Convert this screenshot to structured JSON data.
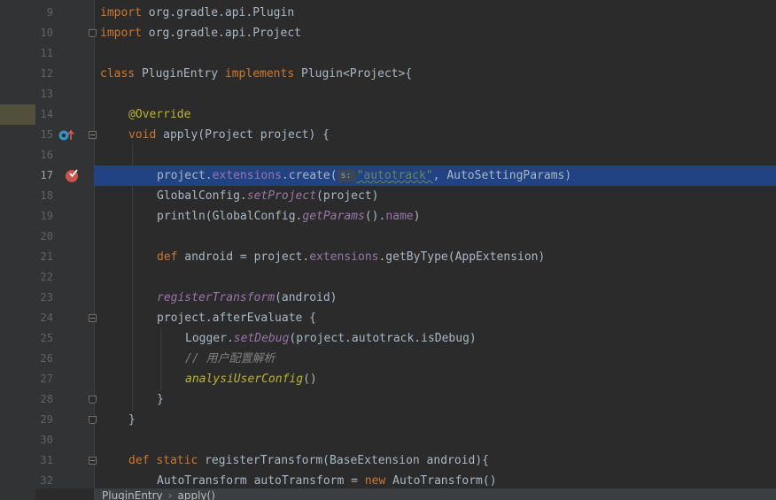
{
  "breadcrumb": {
    "items": [
      "PluginEntry",
      "apply()"
    ]
  },
  "editor": {
    "highlighted_line": 17,
    "lines": [
      {
        "n": "9"
      },
      {
        "n": "10"
      },
      {
        "n": "11"
      },
      {
        "n": "12"
      },
      {
        "n": "13"
      },
      {
        "n": "14"
      },
      {
        "n": "15"
      },
      {
        "n": "16"
      },
      {
        "n": "17"
      },
      {
        "n": "18"
      },
      {
        "n": "19"
      },
      {
        "n": "20"
      },
      {
        "n": "21"
      },
      {
        "n": "22"
      },
      {
        "n": "23"
      },
      {
        "n": "24"
      },
      {
        "n": "25"
      },
      {
        "n": "26"
      },
      {
        "n": "27"
      },
      {
        "n": "28"
      },
      {
        "n": "29"
      },
      {
        "n": "30"
      },
      {
        "n": "31"
      },
      {
        "n": "32"
      }
    ],
    "code": {
      "l9": {
        "kw": "import",
        "rest": " org.gradle.api.Plugin"
      },
      "l10": {
        "kw": "import",
        "rest": " org.gradle.api.Project"
      },
      "l12": {
        "kw1": "class",
        "name": " PluginEntry ",
        "kw2": "implements",
        "rest": " Plugin<Project>{"
      },
      "l14": {
        "ann": "@Override"
      },
      "l15": {
        "kw": "void",
        "rest": " apply(Project project) {"
      },
      "l17": {
        "a": "project.",
        "f1": "extensions",
        "b": ".create(",
        "hint": "s:",
        "str": "\"autotrack\"",
        "c": ", AutoSettingParams)"
      },
      "l18": {
        "a": "GlobalConfig.",
        "m": "setProject",
        "b": "(project)"
      },
      "l19": {
        "a": "println(GlobalConfig.",
        "m": "getParams",
        "b": "().",
        "f": "name",
        "c": ")"
      },
      "l21": {
        "kw": "def",
        "a": " android = project.",
        "f": "extensions",
        "b": ".getByType(AppExtension)"
      },
      "l23": {
        "m": "registerTransform",
        "b": "(android)"
      },
      "l24": {
        "a": "project.afterEvaluate {"
      },
      "l25": {
        "a": "Logger.",
        "m": "setDebug",
        "b": "(project.autotrack.isDebug)"
      },
      "l26": {
        "cmt": "// 用户配置解析"
      },
      "l27": {
        "m": "analysiUserConfig",
        "b": "()"
      },
      "l28": {
        "a": "}"
      },
      "l29": {
        "a": "}"
      },
      "l31": {
        "kw1": "def",
        "kw2": "static",
        "a": " registerTransform(BaseExtension android){"
      },
      "l32": {
        "a": "AutoTransform autoTransform = ",
        "kw": "new",
        "b": " AutoTransform()"
      }
    }
  },
  "gutter_icons": {
    "l15": "override-implements-icon",
    "l17": "breakpoint-icon"
  },
  "colors": {
    "background": "#2b2b2b",
    "gutter": "#313335",
    "selection": "#214283",
    "keyword": "#cc7832",
    "annotation": "#bbb529",
    "field": "#9876aa",
    "string": "#6a8759",
    "comment": "#808080",
    "breakpoint": "#c75450"
  }
}
